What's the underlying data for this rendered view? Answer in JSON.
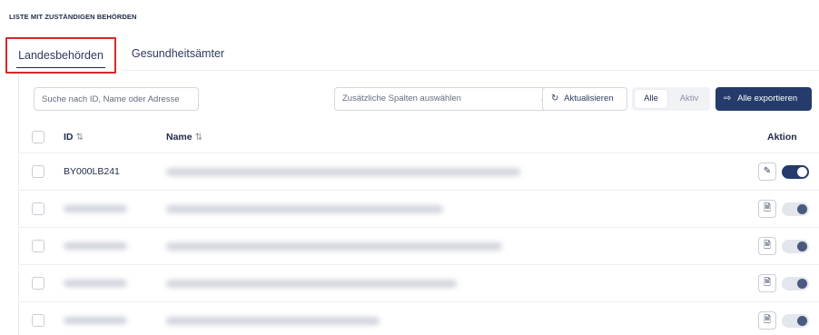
{
  "page": {
    "title": "LISTE MIT ZUSTÄNDIGEN BEHÖRDEN"
  },
  "tabs": [
    {
      "label": "Landesbehörden",
      "active": true
    },
    {
      "label": "Gesundheitsämter",
      "active": false
    }
  ],
  "toolbar": {
    "search_placeholder": "Suche nach ID, Name oder Adresse",
    "columns_select": "Zusätzliche Spalten auswählen",
    "refresh_label": "Aktualisieren",
    "filter_all": "Alle",
    "filter_active": "Aktiv",
    "export_label": "Alle exportieren"
  },
  "table": {
    "headers": {
      "id": "ID",
      "name": "Name",
      "action": "Aktion"
    },
    "rows": [
      {
        "id": "BY000LB241",
        "action_icon": "pencil-icon",
        "enabled": true
      },
      {
        "id": "",
        "action_icon": "document-icon",
        "enabled": false
      },
      {
        "id": "",
        "action_icon": "document-icon",
        "enabled": false
      },
      {
        "id": "",
        "action_icon": "document-icon",
        "enabled": false
      },
      {
        "id": "",
        "action_icon": "document-icon",
        "enabled": false
      }
    ]
  },
  "colors": {
    "accent": "#243b6b",
    "highlight": "#d42a2a"
  }
}
